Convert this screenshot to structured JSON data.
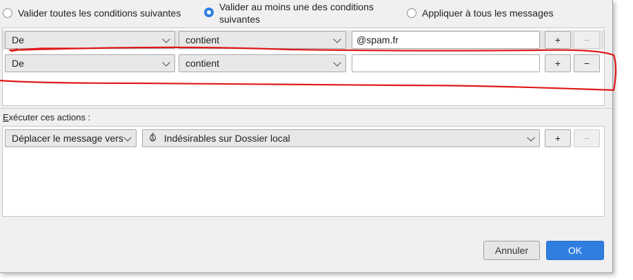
{
  "match_options": [
    {
      "label": "Valider toutes les conditions suivantes",
      "checked": false
    },
    {
      "label_line1": "Valider au moins une des conditions",
      "label_line2": "suivantes",
      "checked": true
    },
    {
      "label": "Appliquer à tous les messages",
      "checked": false
    }
  ],
  "rules": [
    {
      "field": "De",
      "operator": "contient",
      "value": "@spam.fr",
      "add": "+",
      "remove": "−",
      "remove_enabled": false
    },
    {
      "field": "De",
      "operator": "contient",
      "value": "",
      "add": "+",
      "remove": "−",
      "remove_enabled": true
    }
  ],
  "actions_label": "Exécuter ces actions :",
  "actions": [
    {
      "action": "Déplacer le message vers",
      "target": "Indésirables sur Dossier local",
      "target_icon": "fire-icon",
      "add": "+",
      "remove": "−",
      "remove_enabled": false
    }
  ],
  "buttons": {
    "cancel": "Annuler",
    "ok": "OK"
  },
  "colors": {
    "accent": "#2f7ee0",
    "annotation": "#e01818",
    "dialog_bg": "#f1f0f0"
  }
}
